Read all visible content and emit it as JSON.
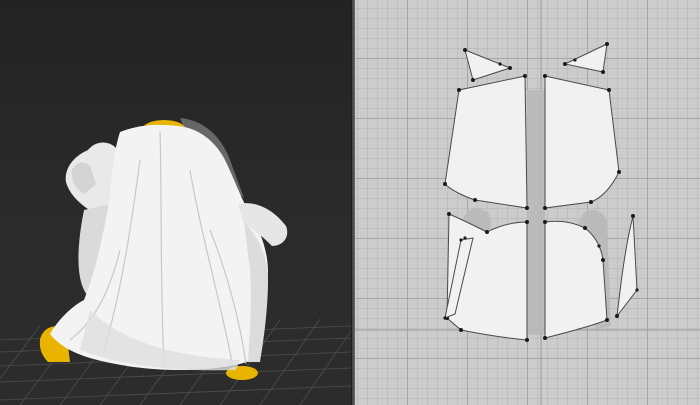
{
  "window": {
    "left_panel": "3d-garment-view",
    "right_panel": "2d-pattern-view"
  },
  "colors": {
    "viewport_3d_bg": "#2a2a2a",
    "viewport_2d_bg": "#cccccc",
    "grid_line": "#a8a8a8",
    "fabric": "#f1f1f1",
    "avatar_skin": "#e8b400",
    "outline": "#4a4a4a",
    "point": "#1a1a1a"
  },
  "icons": [
    "avatar-figure",
    "floor-grid",
    "pattern-point"
  ]
}
